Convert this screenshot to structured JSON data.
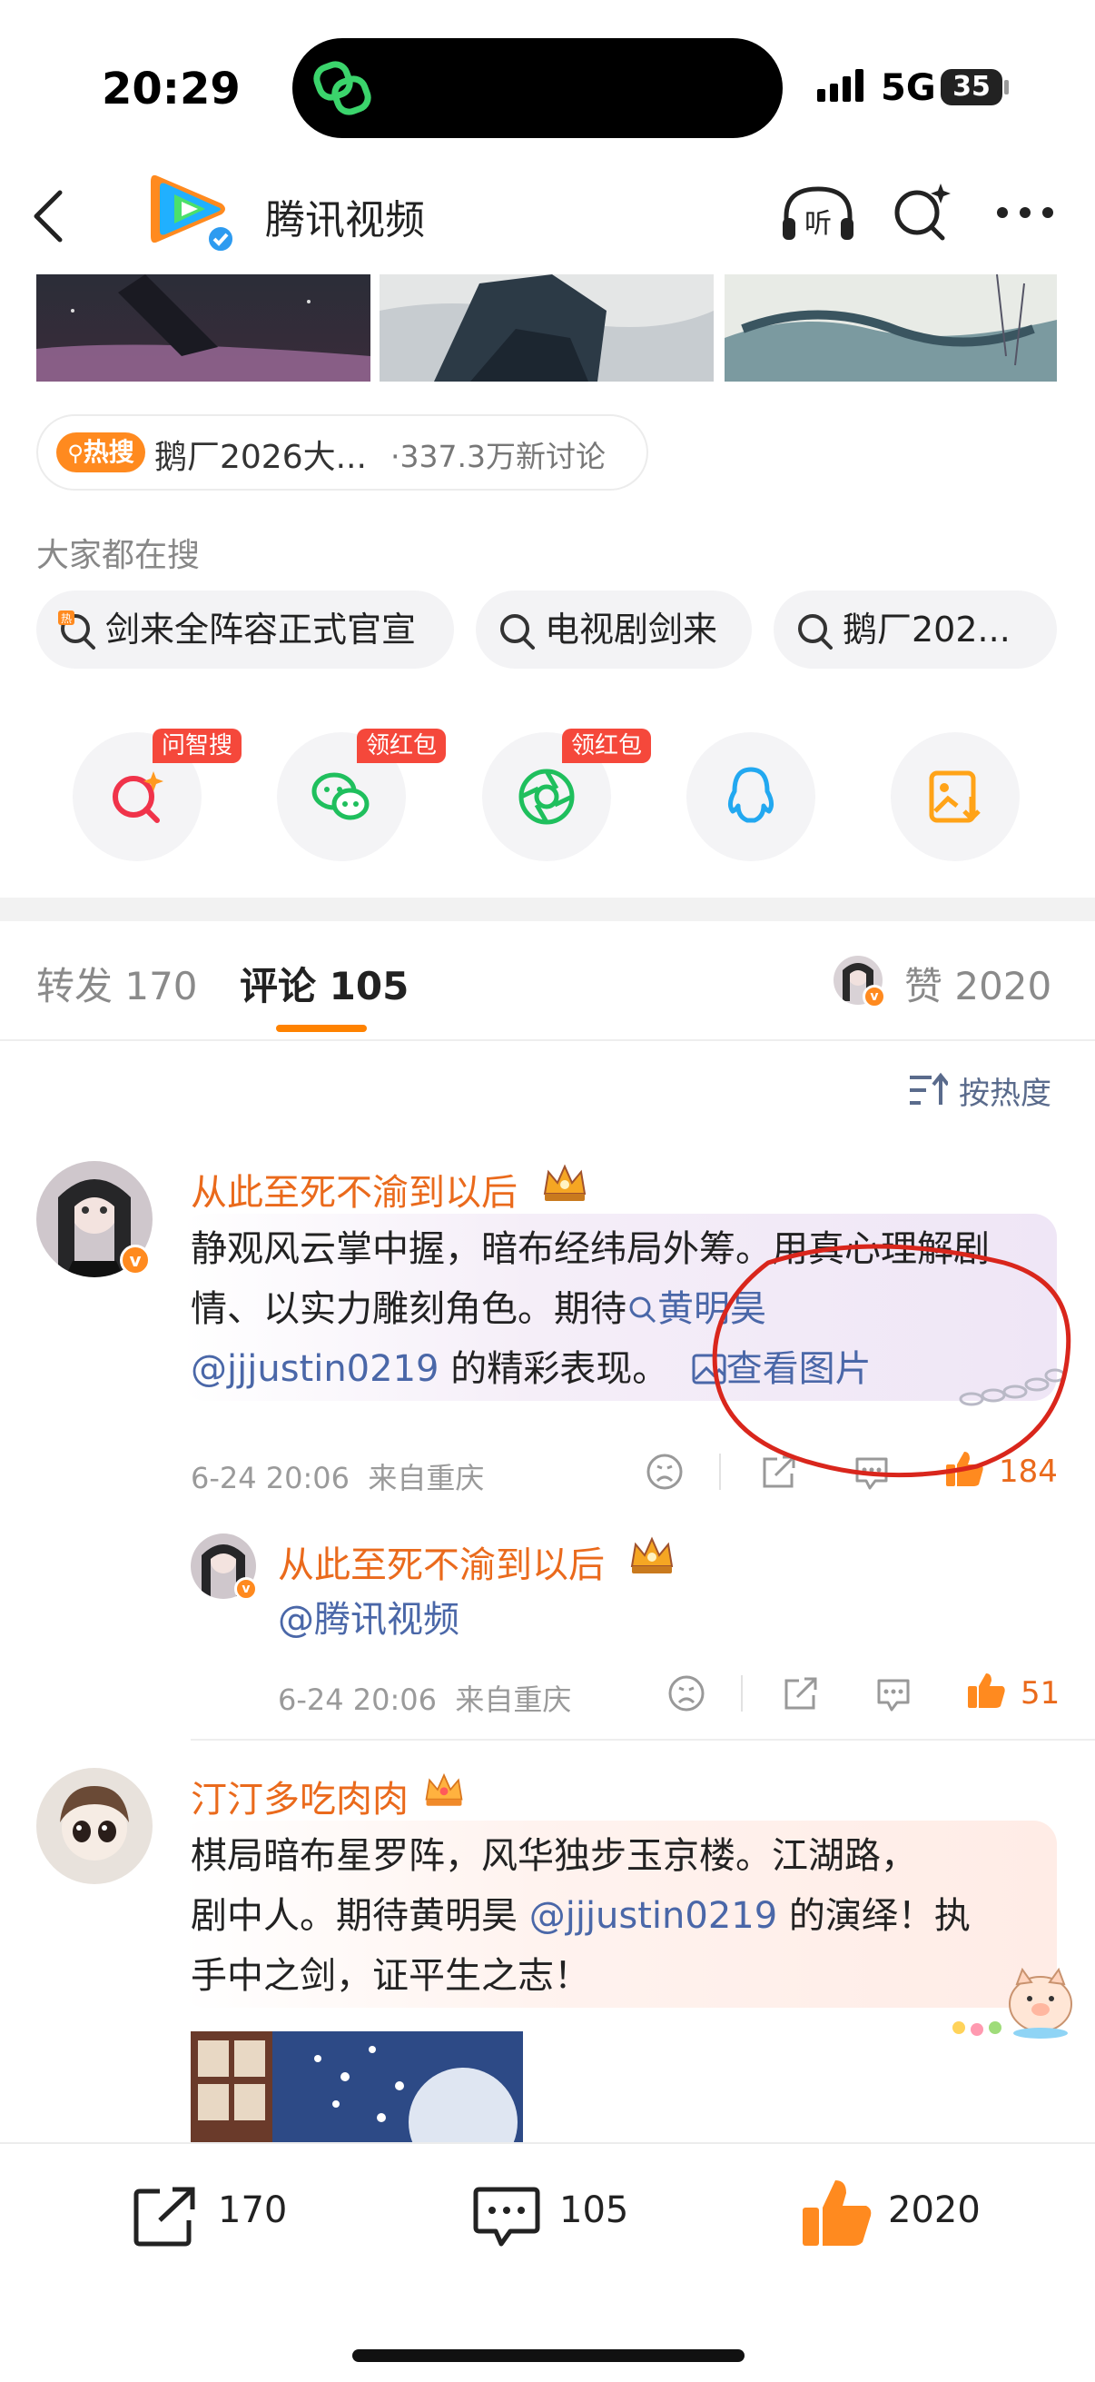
{
  "status": {
    "time": "20:29",
    "network": "5G",
    "battery": "35"
  },
  "header": {
    "title": "腾讯视频",
    "back_icon": "chevron-left-icon",
    "listen_icon": "headphones-icon",
    "listen_label": "听",
    "search_icon": "search-sparkle-icon",
    "more_icon": "more-dots-icon"
  },
  "hot": {
    "badge": "热搜",
    "text": "鹅厂2026大...",
    "count": "·337.3万新讨论"
  },
  "searches": {
    "label": "大家都在搜",
    "chips": [
      "剑来全阵容正式官宣",
      "电视剧剑来",
      "鹅厂202..."
    ]
  },
  "share": {
    "items": [
      {
        "icon": "ai-search-icon",
        "badge": "问智搜"
      },
      {
        "icon": "wechat-icon",
        "badge": "领红包"
      },
      {
        "icon": "moments-icon",
        "badge": "领红包"
      },
      {
        "icon": "qq-icon",
        "badge": ""
      },
      {
        "icon": "save-image-icon",
        "badge": ""
      }
    ]
  },
  "tabs": {
    "repost": "转发 170",
    "comment": "评论 105",
    "like": "赞 2020"
  },
  "sort": {
    "label": "按热度"
  },
  "comments": [
    {
      "user": "从此至死不渝到以后",
      "text_before": "静观风云掌中握，暗布经纬局外筹。用真心理解剧情、以实力雕刻角色。期待",
      "search_link": "黄明昊",
      "mention": "@jjjustin0219",
      "text_after": " 的精彩表现。",
      "view_image": "查看图片",
      "time": "6-24 20:06",
      "location": "来自重庆",
      "likes": "184",
      "reply": {
        "user": "从此至死不渝到以后",
        "mention": "@腾讯视频",
        "time": "6-24 20:06",
        "location": "来自重庆",
        "likes": "51"
      }
    },
    {
      "user": "汀汀多吃肉肉",
      "text_line1": "棋局暗布星罗阵，风华独步玉京楼。江湖路，",
      "text_line2a": "剧中人。期待黄明昊 ",
      "mention": "@jjjustin0219",
      "text_line2b": " 的演绎！执",
      "text_line3": "手中之剑，证平生之志！"
    }
  ],
  "bottom": {
    "repost": "170",
    "comment": "105",
    "like": "2020"
  },
  "colors": {
    "accent": "#ff8200",
    "username": "#ea6a1c",
    "link": "#4a67a8",
    "annotation_circle": "#d9261c"
  }
}
